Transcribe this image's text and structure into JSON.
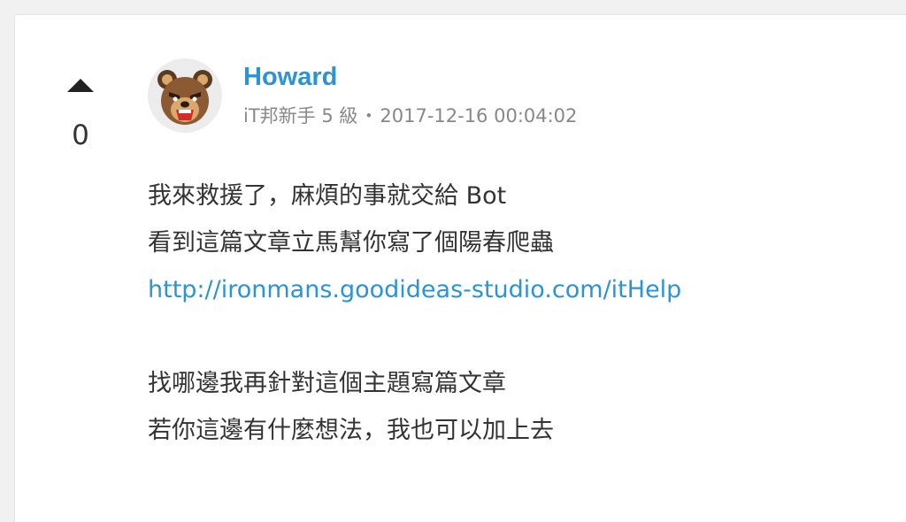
{
  "vote": {
    "count": "0"
  },
  "author": {
    "name": "Howard",
    "rank": "iT邦新手 5 級",
    "separator": "・",
    "timestamp": "2017-12-16 00:04:02"
  },
  "content": {
    "lines": [
      "我來救援了，麻煩的事就交給 Bot",
      "看到這篇文章立馬幫你寫了個陽春爬蟲"
    ],
    "link": "http://ironmans.goodideas-studio.com/itHelp",
    "lines_after": [
      "找哪邊我再針對這個主題寫篇文章",
      "若你這邊有什麼想法，我也可以加上去"
    ]
  },
  "colors": {
    "link": "#2a94d6",
    "text": "#333333",
    "meta": "#888888"
  },
  "icons": {
    "upvote": "triangle-up-icon",
    "avatar": "bear-avatar"
  }
}
